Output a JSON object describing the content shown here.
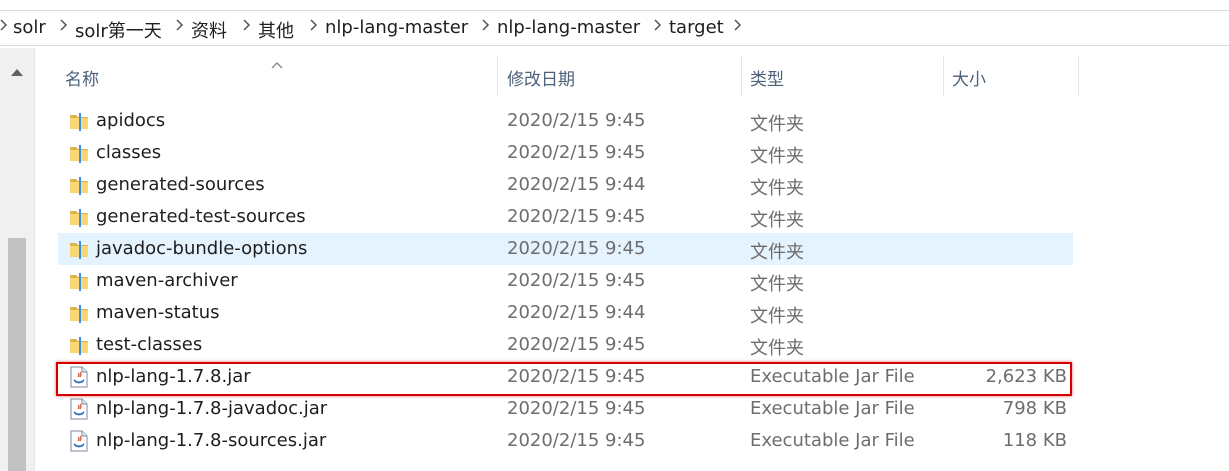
{
  "breadcrumb": [
    "solr",
    "solr第一天",
    "资料",
    "其他",
    "nlp-lang-master",
    "nlp-lang-master",
    "target"
  ],
  "columns": {
    "name": "名称",
    "date": "修改日期",
    "type": "类型",
    "size": "大小"
  },
  "files": [
    {
      "name": "apidocs",
      "date": "2020/2/15 9:45",
      "type": "文件夹",
      "size": "",
      "icon": "folder-icon"
    },
    {
      "name": "classes",
      "date": "2020/2/15 9:45",
      "type": "文件夹",
      "size": "",
      "icon": "folder-icon"
    },
    {
      "name": "generated-sources",
      "date": "2020/2/15 9:44",
      "type": "文件夹",
      "size": "",
      "icon": "folder-icon"
    },
    {
      "name": "generated-test-sources",
      "date": "2020/2/15 9:45",
      "type": "文件夹",
      "size": "",
      "icon": "folder-icon"
    },
    {
      "name": "javadoc-bundle-options",
      "date": "2020/2/15 9:45",
      "type": "文件夹",
      "size": "",
      "icon": "folder-icon"
    },
    {
      "name": "maven-archiver",
      "date": "2020/2/15 9:45",
      "type": "文件夹",
      "size": "",
      "icon": "folder-icon"
    },
    {
      "name": "maven-status",
      "date": "2020/2/15 9:44",
      "type": "文件夹",
      "size": "",
      "icon": "folder-icon"
    },
    {
      "name": "test-classes",
      "date": "2020/2/15 9:45",
      "type": "文件夹",
      "size": "",
      "icon": "folder-icon"
    },
    {
      "name": "nlp-lang-1.7.8.jar",
      "date": "2020/2/15 9:45",
      "type": "Executable Jar File",
      "size": "2,623 KB",
      "icon": "jar-file-icon"
    },
    {
      "name": "nlp-lang-1.7.8-javadoc.jar",
      "date": "2020/2/15 9:45",
      "type": "Executable Jar File",
      "size": "798 KB",
      "icon": "jar-file-icon"
    },
    {
      "name": "nlp-lang-1.7.8-sources.jar",
      "date": "2020/2/15 9:45",
      "type": "Executable Jar File",
      "size": "118 KB",
      "icon": "jar-file-icon"
    }
  ],
  "colors": {
    "hover_row": "#e5f3ff",
    "highlight_border": "#d40000",
    "folder": "#f8d775",
    "header_text": "#4c607a"
  }
}
